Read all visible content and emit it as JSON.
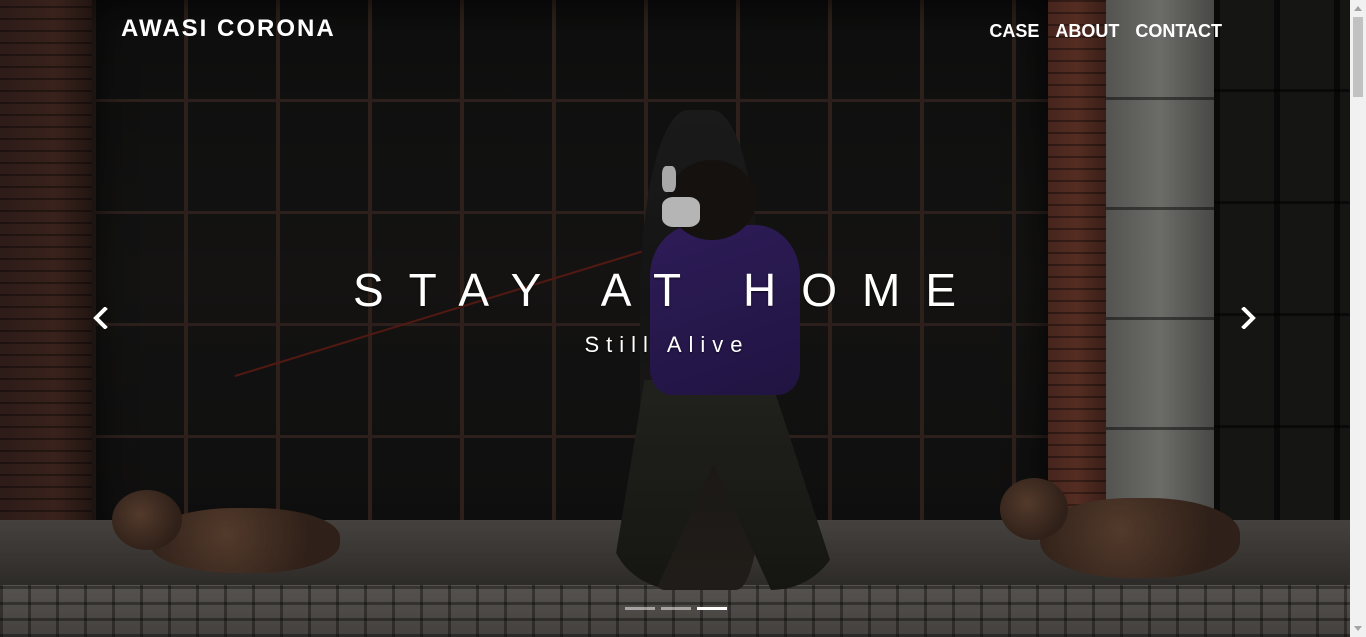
{
  "navbar": {
    "brand": "AWASI CORONA",
    "links": [
      "CASE",
      "ABOUT",
      "CONTACT"
    ]
  },
  "hero": {
    "title": "STAY AT HOME",
    "subtitle": "Still Alive",
    "background_icon": "masked-people-walking-dogs-photo"
  },
  "carousel": {
    "slide_count": 3,
    "active_index": 2,
    "prev_icon": "chevron-left-icon",
    "next_icon": "chevron-right-icon"
  },
  "colors": {
    "text": "#ffffff",
    "indicator_inactive": "rgba(255,255,255,0.5)",
    "indicator_active": "#ffffff"
  }
}
